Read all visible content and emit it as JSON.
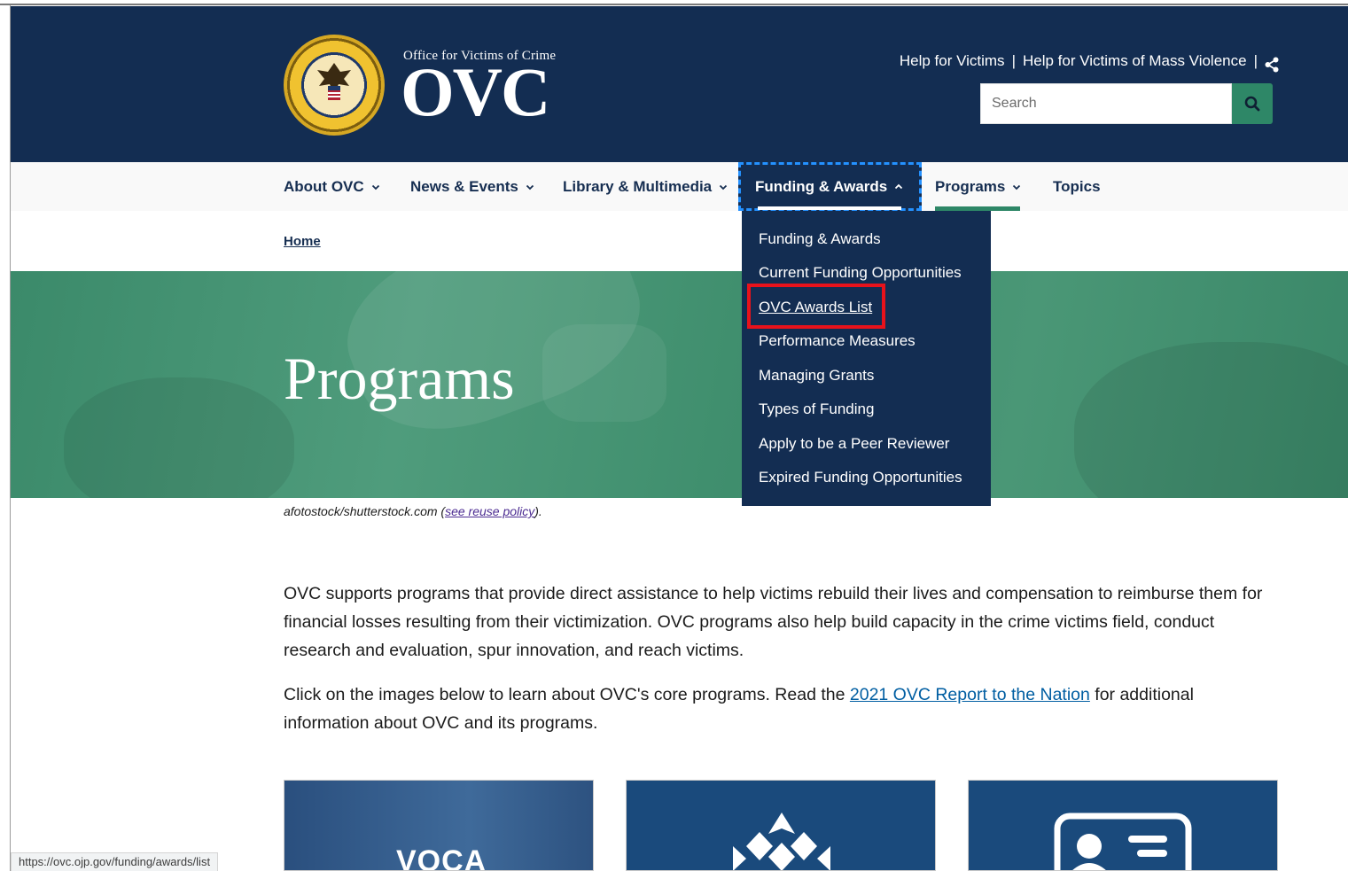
{
  "header": {
    "logo_small": "Office for Victims of Crime",
    "logo_big": "OVC",
    "top_links": [
      "Help for Victims",
      "Help for Victims of Mass Violence"
    ],
    "search_placeholder": "Search"
  },
  "nav": {
    "items": [
      {
        "label": "About OVC",
        "has_caret": true
      },
      {
        "label": "News & Events",
        "has_caret": true
      },
      {
        "label": "Library & Multimedia",
        "has_caret": true
      },
      {
        "label": "Funding & Awards",
        "has_caret": true,
        "expanded": true
      },
      {
        "label": "Programs",
        "has_caret": true,
        "current": true
      },
      {
        "label": "Topics",
        "has_caret": false
      }
    ]
  },
  "dropdown": {
    "items": [
      "Funding & Awards",
      "Current Funding Opportunities",
      "OVC Awards List",
      "Performance Measures",
      "Managing Grants",
      "Types of Funding",
      "Apply to be a Peer Reviewer",
      "Expired Funding Opportunities"
    ]
  },
  "breadcrumb": {
    "home": "Home"
  },
  "hero": {
    "title": "Programs"
  },
  "credit": {
    "source": "afotostock/shutterstock.com",
    "open": " (",
    "link": "see reuse policy",
    "close": ")."
  },
  "content": {
    "para1": "OVC supports programs that provide direct assistance to help victims rebuild their lives and compensation to reimburse them for financial losses resulting from their victimization. OVC programs also help build capacity in the crime victims field, conduct research and evaluation, spur innovation, and reach victims.",
    "para2_before": "Click on the images below to learn about OVC's core programs. Read the ",
    "para2_link": "2021 OVC Report to the Nation",
    "para2_after": " for additional information about OVC and its programs."
  },
  "cards": {
    "card1_label": "VOCA"
  },
  "status_bar": {
    "url": "https://ovc.ojp.gov/funding/awards/list"
  },
  "colors": {
    "header_bg": "#132d52",
    "accent_green": "#2e8767",
    "link_blue": "#005ea2",
    "highlight_red": "#e8121b"
  }
}
